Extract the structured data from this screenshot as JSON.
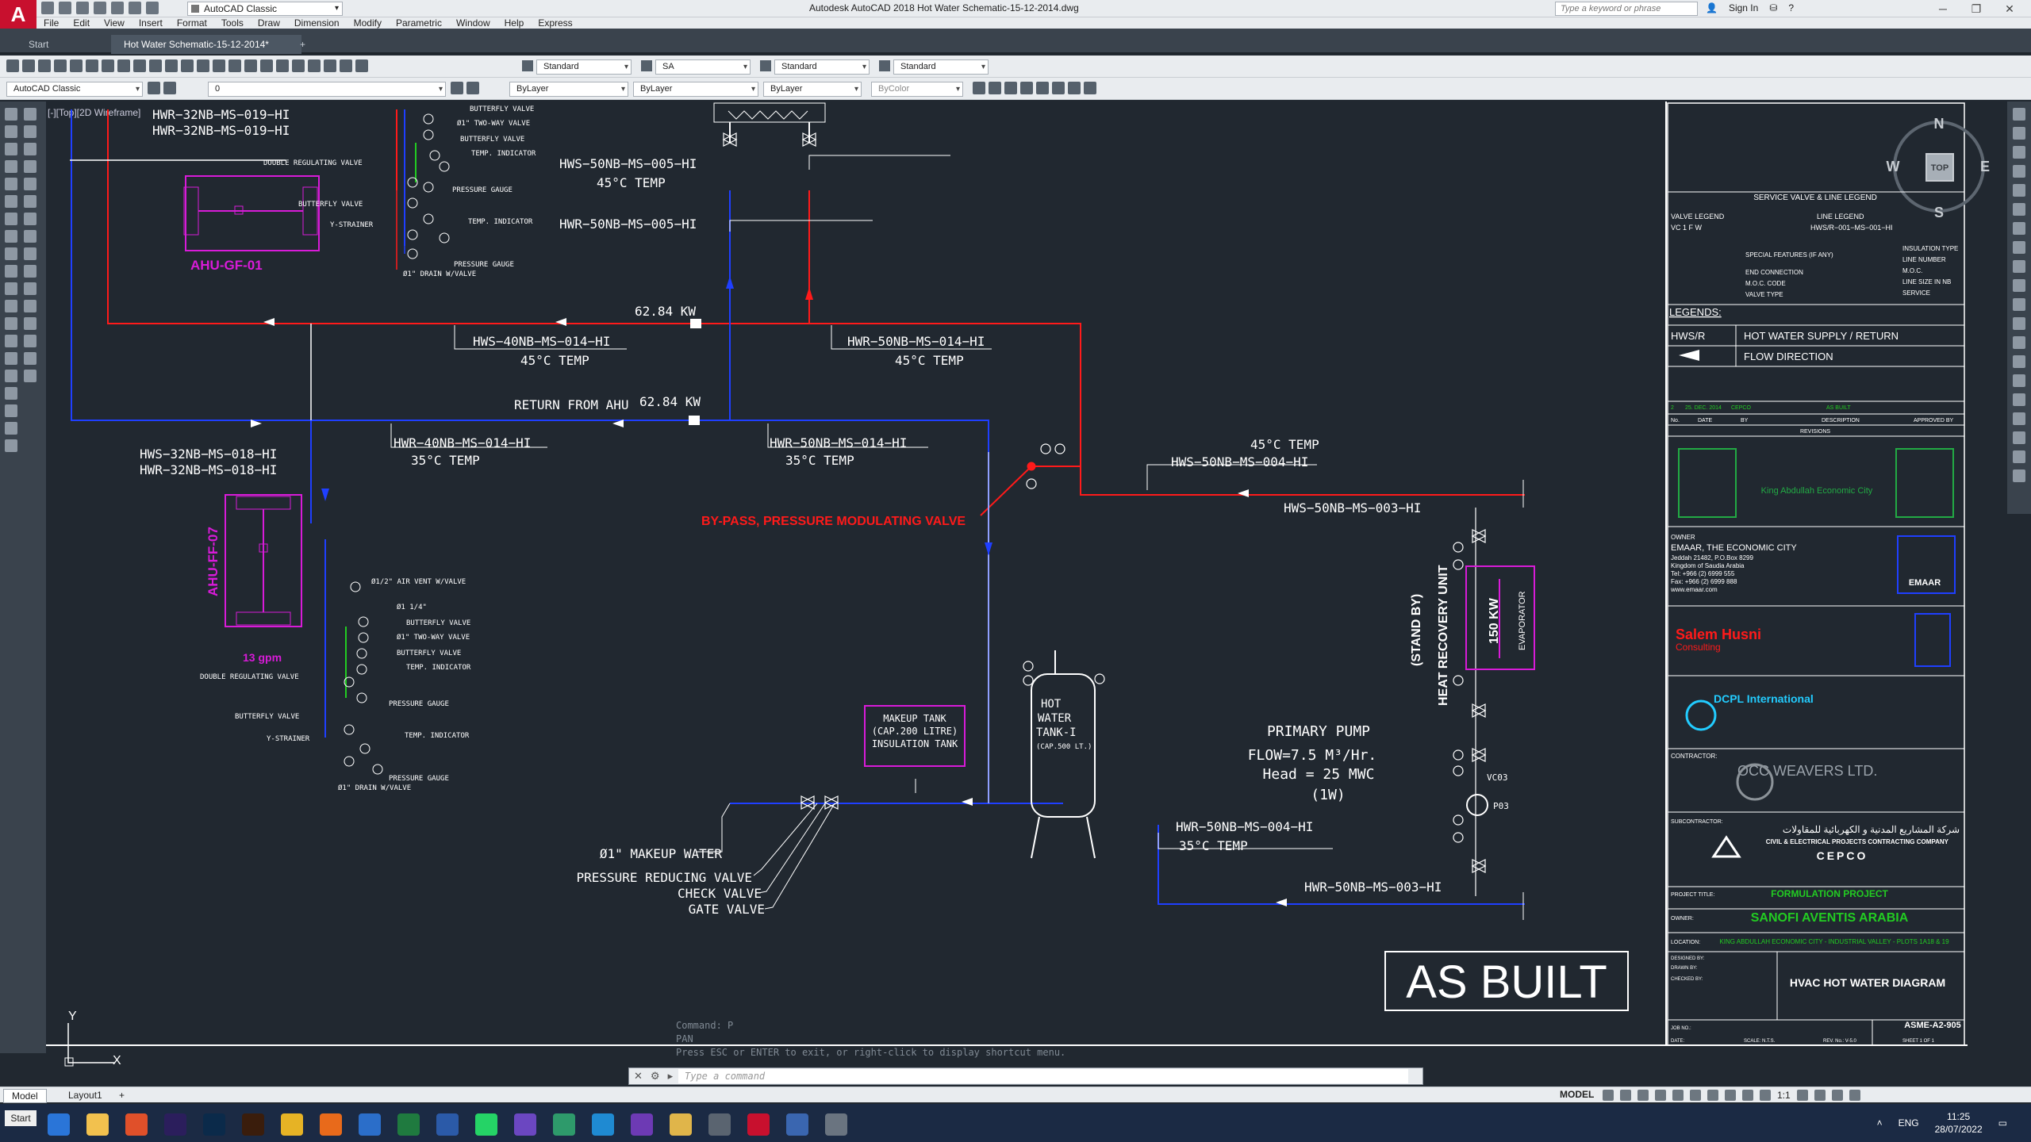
{
  "app": {
    "logo": "A",
    "workspace": "AutoCAD Classic",
    "window_title": "Autodesk AutoCAD 2018   Hot Water Schematic-15-12-2014.dwg",
    "search_placeholder": "Type a keyword or phrase",
    "sign_in": "Sign In"
  },
  "menu": [
    "File",
    "Edit",
    "View",
    "Insert",
    "Format",
    "Tools",
    "Draw",
    "Dimension",
    "Modify",
    "Parametric",
    "Window",
    "Help",
    "Express"
  ],
  "tabs": {
    "start": "Start",
    "file": "Hot Water Schematic-15-12-2014*",
    "add": "+"
  },
  "toolbar": {
    "text_style": "Standard",
    "dim_style": "SA",
    "table_style": "Standard",
    "mleader_style": "Standard",
    "workspace": "AutoCAD Classic",
    "layer": "0",
    "color": "ByLayer",
    "linetype": "ByLayer",
    "lineweight": "ByLayer",
    "plotstyle": "ByColor"
  },
  "viewport": {
    "label": "[-][Top][2D Wireframe]",
    "viewcube": {
      "n": "N",
      "s": "S",
      "e": "E",
      "w": "W",
      "top": "TOP"
    },
    "ucs_y": "Y",
    "ucs_x": "X"
  },
  "drawing": {
    "ahu_gf": "AHU-GF-01",
    "ahu_ff": "AHU-FF-07",
    "gpm": "13 gpm",
    "pipes": {
      "p1": "HWR−32NB−MS−019−HI",
      "p2": "HWR−32NB−MS−019−HI",
      "p3": "HWS−50NB−MS−005−HI",
      "p3t": "45°C TEMP",
      "p4": "HWR−50NB−MS−005−HI",
      "kw1": "62.84 KW",
      "p5": "HWS−40NB−MS−014−HI",
      "p5t": "45°C TEMP",
      "p6": "HWR−50NB−MS−014−HI",
      "p6t": "45°C TEMP",
      "ret": "RETURN FROM AHU",
      "kw2": "62.84 KW",
      "p7": "HWR−40NB−MS−014−HI",
      "p7t": "35°C TEMP",
      "p8": "HWR−50NB−MS−014−HI",
      "p8t": "35°C TEMP",
      "p9": "HWS−32NB−MS−018−HI",
      "p10": "HWR−32NB−MS−018−HI",
      "p11t": "45°C TEMP",
      "p11": "HWS−50NB−MS−004−HI",
      "p12": "HWS−50NB−MS−003−HI",
      "p13": "HWR−50NB−MS−004−HI",
      "p13t": "35°C TEMP",
      "p14": "HWR−50NB−MS−003−HI"
    },
    "bypass": "BY-PASS, PRESSURE MODULATING VALVE",
    "valves_top": [
      "BUTTERFLY VALVE",
      "Ø1\" TWO-WAY VALVE",
      "BUTTERFLY VALVE",
      "TEMP. INDICATOR",
      "DOUBLE REGULATING VALVE",
      "PRESSURE GAUGE",
      "BUTTERFLY VALVE",
      "TEMP. INDICATOR",
      "Y-STRAINER",
      "PRESSURE GAUGE",
      "Ø1\" DRAIN W/VALVE"
    ],
    "valves_bot": [
      "Ø1/2\" AIR VENT W/VALVE",
      "Ø1 1/4\"",
      "BUTTERFLY VALVE",
      "Ø1\" TWO-WAY VALVE",
      "BUTTERFLY VALVE",
      "TEMP. INDICATOR",
      "DOUBLE REGULATING VALVE",
      "PRESSURE GAUGE",
      "BUTTERFLY VALVE",
      "TEMP. INDICATOR",
      "Y-STRAINER",
      "PRESSURE GAUGE",
      "Ø1\" DRAIN W/VALVE"
    ],
    "makeup_tank": [
      "MAKEUP TANK",
      "(CAP.200 LITRE)",
      "INSULATION TANK"
    ],
    "hot_tank": [
      "HOT",
      "WATER",
      "TANK-I",
      "(CAP.500 LT.)"
    ],
    "makeup_labels": [
      "Ø1\" MAKEUP WATER",
      "PRESSURE REDUCING VALVE",
      "CHECK VALVE",
      "GATE VALVE"
    ],
    "pump": [
      "PRIMARY PUMP",
      "FLOW=7.5 M³/Hr.",
      "Head = 25 MWC",
      "(1W)"
    ],
    "hru": "HEAT RECOVERY UNIT",
    "standby": "(STAND BY)",
    "kw150": "150 KW",
    "evaporator": "EVAPORATOR",
    "vc03": "VC03",
    "p03": "P03",
    "as_built": "AS BUILT"
  },
  "titleblock": {
    "legend_title": "SERVICE VALVE & LINE LEGEND",
    "valve_legend": "VALVE LEGEND",
    "valve_code": "VC 1  F  W",
    "line_legend": "LINE LEGEND",
    "line_code": "HWS/R−001−MS−001−HI",
    "vl_items": [
      "SPECIAL FEATURES (IF ANY)",
      "END CONNECTION",
      "M.O.C. CODE",
      "VALVE TYPE"
    ],
    "ll_items": [
      "INSULATION TYPE",
      "LINE NUMBER",
      "M.O.C.",
      "LINE SIZE IN NB",
      "SERVICE"
    ],
    "legends": "LEGENDS:",
    "hws": "HWS/R",
    "hws_desc": "HOT WATER SUPPLY / RETURN",
    "flow_desc": "FLOW DIRECTION",
    "rev_row": [
      "2",
      "25. DEC. 2014",
      "CEPCO",
      "AS BUILT",
      ""
    ],
    "rev_headers": [
      "No.",
      "DATE",
      "BY",
      "DESCRIPTION",
      "APPROVED BY"
    ],
    "revisions": "REVISIONS",
    "kaec": "King Abdullah Economic City",
    "owner_lbl": "OWNER",
    "owner": "EMAAR, THE ECONOMIC CITY",
    "owner_addr": [
      "Jeddah 21482, P.O.Box 8299",
      "Kingdom of Saudia Arabia",
      "Tel: +966 (2) 6999 555",
      "Fax: +966 (2) 6999 888",
      "www.emaar.com"
    ],
    "emaar": "EMAAR",
    "consultant": "Salem Husni",
    "consultant_sub": "Consulting",
    "dcpl": "DCPL International",
    "occ": "OCC WEAVERS LTD.",
    "contractor_lbl": "CONTRACTOR:",
    "subcontractor_lbl": "SUBCONTRACTOR:",
    "cepco_ar": "شركة المشاريع المدنية و الكهربائية للمقاولات",
    "cepco_en": "CIVIL & ELECTRICAL PROJECTS CONTRACTING COMPANY",
    "cepco": "CEPCO",
    "project_lbl": "PROJECT TITLE:",
    "project": "FORMULATION PROJECT",
    "owner2_lbl": "OWNER:",
    "owner2": "SANOFI AVENTIS ARABIA",
    "location_lbl": "LOCATION:",
    "location": "KING ABDULLAH ECONOMIC CITY - INDUSTRIAL VALLEY - PLOTS 1A18 & 19",
    "sheet_title": "HVAC HOT WATER DIAGRAM",
    "sheet_no": "ASME-A2-905",
    "designed": "DESIGNED BY:",
    "drawn": "DRAWN BY:",
    "checked": "CHECKED BY:",
    "job": "JOB NO.:",
    "date": "DATE:",
    "scale": "SCALE: N.T.S.",
    "rev": "REV. No.: V-5.0",
    "sheet": "SHEET  1  OF  1"
  },
  "command": {
    "history": [
      "Command: P",
      "PAN",
      "Press ESC or ENTER to exit, or right-click to display shortcut menu."
    ],
    "placeholder": "Type a command"
  },
  "status": {
    "model_tab": "Model",
    "layout_tab": "Layout1",
    "model": "MODEL",
    "scale": "1:1"
  },
  "taskbar": {
    "start": "Start",
    "lang": "ENG",
    "time": "11:25",
    "date": "28/07/2022"
  },
  "colors": {
    "supply": "#ff1a1a",
    "return": "#1f3fff",
    "equipment": "#d81bd8",
    "lines": "#ffffff",
    "bg": "#212830"
  }
}
